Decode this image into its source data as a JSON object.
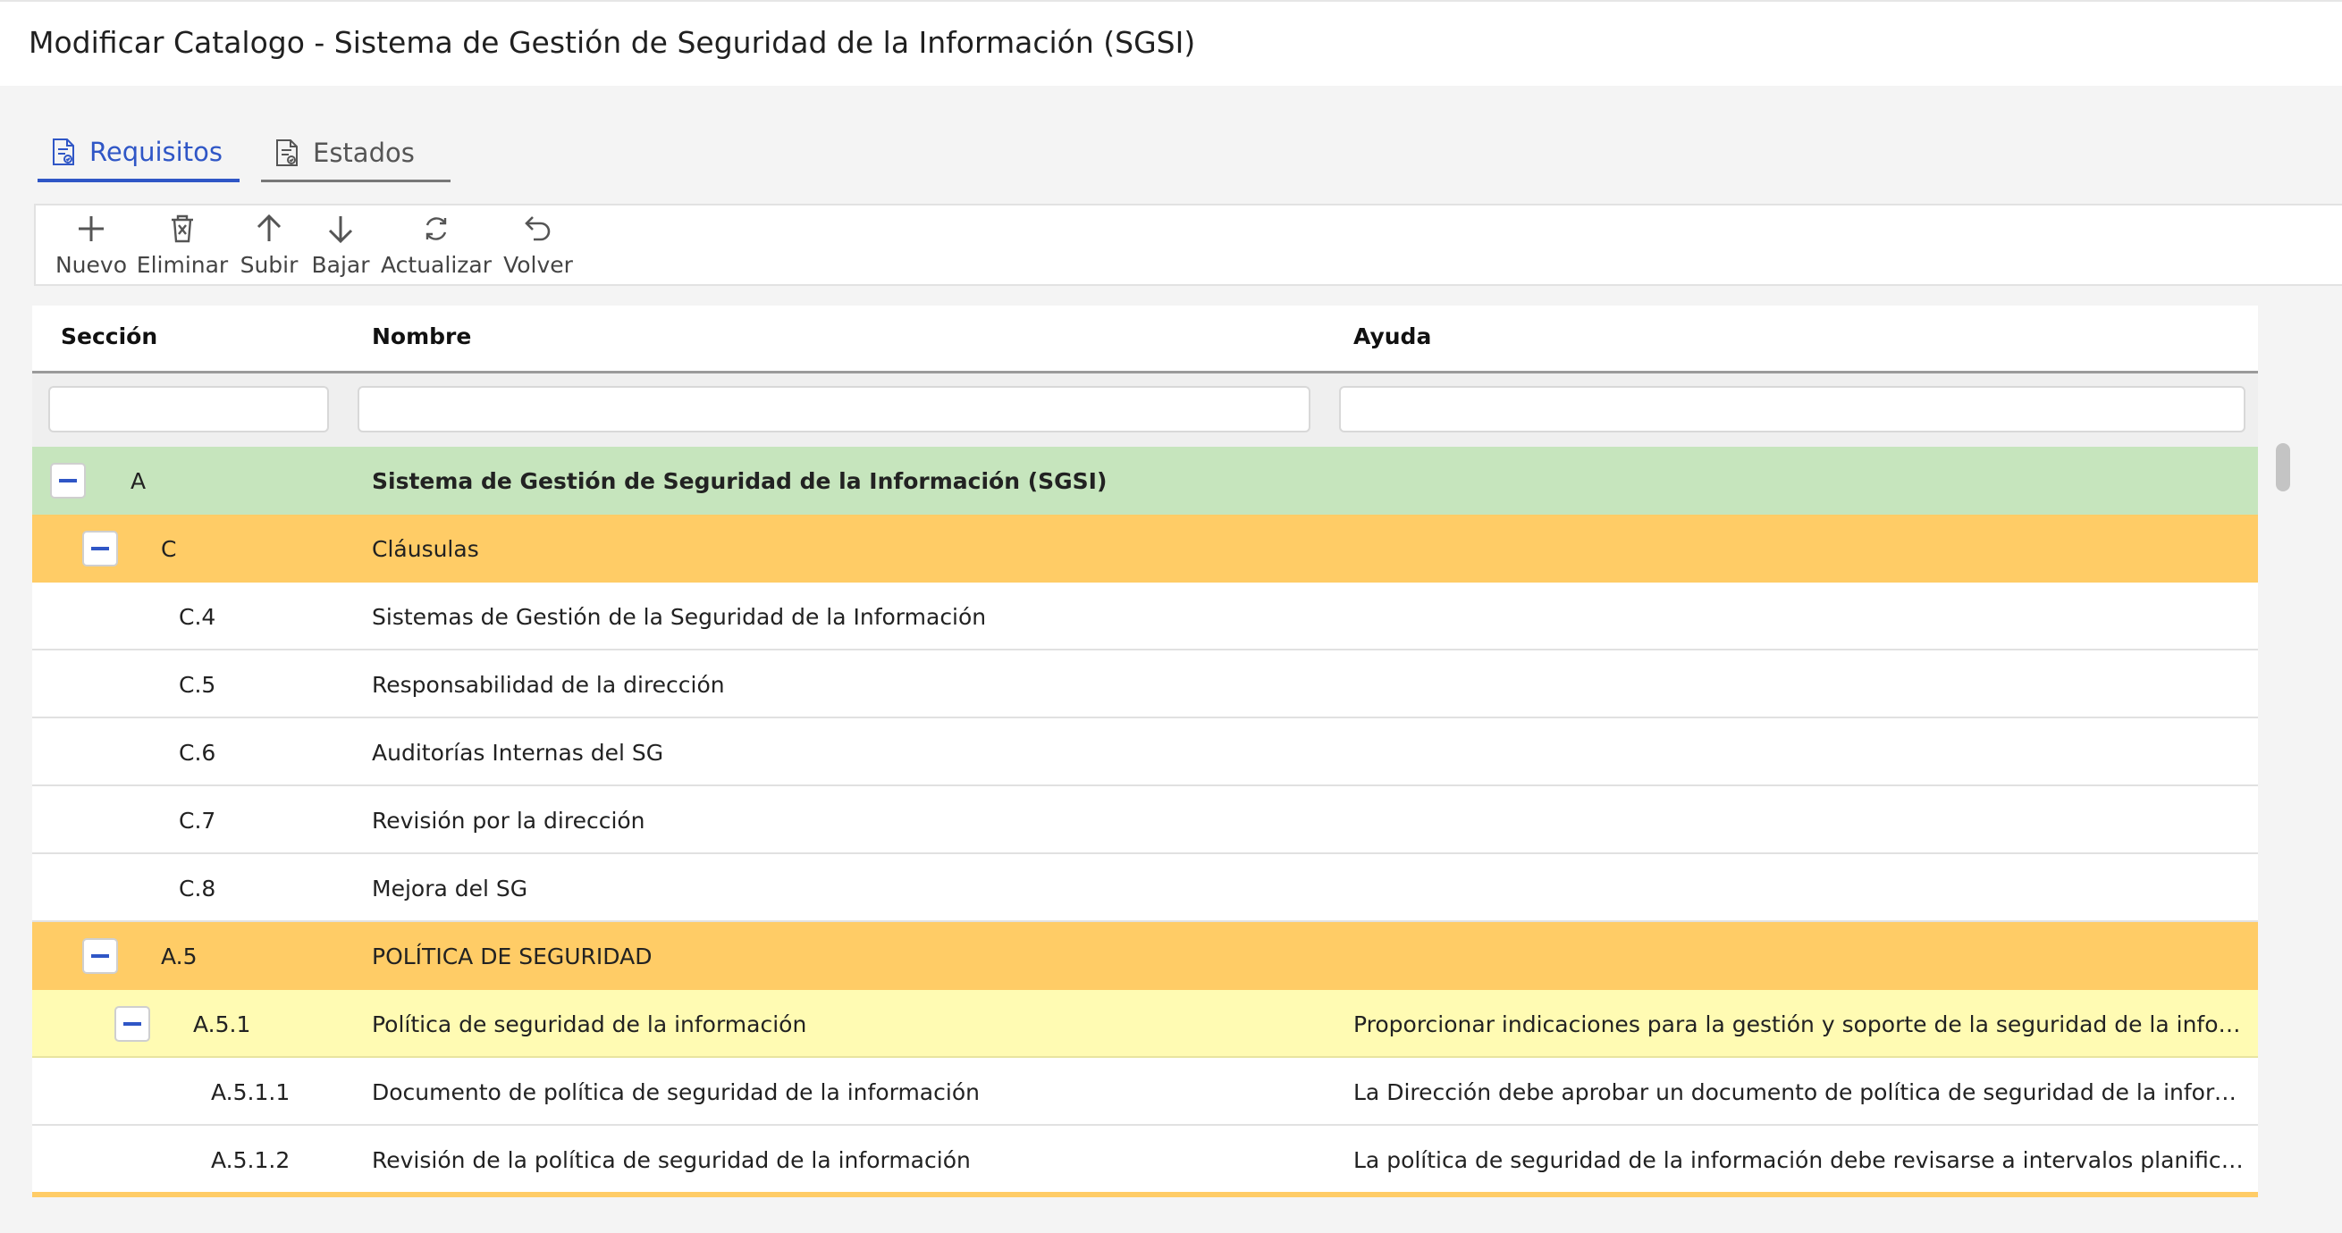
{
  "page": {
    "title": "Modificar Catalogo - Sistema de Gestión de Seguridad de la Información (SGSI)"
  },
  "tabs": [
    {
      "label": "Requisitos",
      "icon": "document-checklist-icon",
      "active": true
    },
    {
      "label": "Estados",
      "icon": "document-checklist-icon",
      "active": false
    }
  ],
  "toolbar": {
    "new_label": "Nuevo",
    "delete_label": "Eliminar",
    "up_label": "Subir",
    "down_label": "Bajar",
    "refresh_label": "Actualizar",
    "back_label": "Volver"
  },
  "grid": {
    "columns": {
      "section": "Sección",
      "name": "Nombre",
      "help": "Ayuda"
    },
    "filters": {
      "section": "",
      "name": "",
      "help": ""
    },
    "rows": [
      {
        "section": "A",
        "name": "Sistema de Gestión de Seguridad de la Información (SGSI)",
        "help": ""
      },
      {
        "section": "C",
        "name": "Cláusulas",
        "help": ""
      },
      {
        "section": "C.4",
        "name": "Sistemas de Gestión de la Seguridad de la Información",
        "help": ""
      },
      {
        "section": "C.5",
        "name": "Responsabilidad de la dirección",
        "help": ""
      },
      {
        "section": "C.6",
        "name": "Auditorías Internas del SG",
        "help": ""
      },
      {
        "section": "C.7",
        "name": "Revisión por la dirección",
        "help": ""
      },
      {
        "section": "C.8",
        "name": "Mejora del SG",
        "help": ""
      },
      {
        "section": "A.5",
        "name": "POLÍTICA DE SEGURIDAD",
        "help": ""
      },
      {
        "section": "A.5.1",
        "name": "Política de seguridad de la información",
        "help": "Proporcionar indicaciones para la gestión y soporte de la seguridad de la inform..."
      },
      {
        "section": "A.5.1.1",
        "name": "Documento de política de seguridad de la información",
        "help": "La Dirección debe aprobar un documento de política de seguridad de la informa..."
      },
      {
        "section": "A.5.1.2",
        "name": "Revisión de la política de seguridad de la información",
        "help": "La política de seguridad de la información debe revisarse a intervalos planificad..."
      }
    ]
  },
  "colors": {
    "accent": "#2f56c6",
    "root_row": "#c6e5bd",
    "group_row": "#ffcc66",
    "sub_row": "#fffbb3"
  }
}
